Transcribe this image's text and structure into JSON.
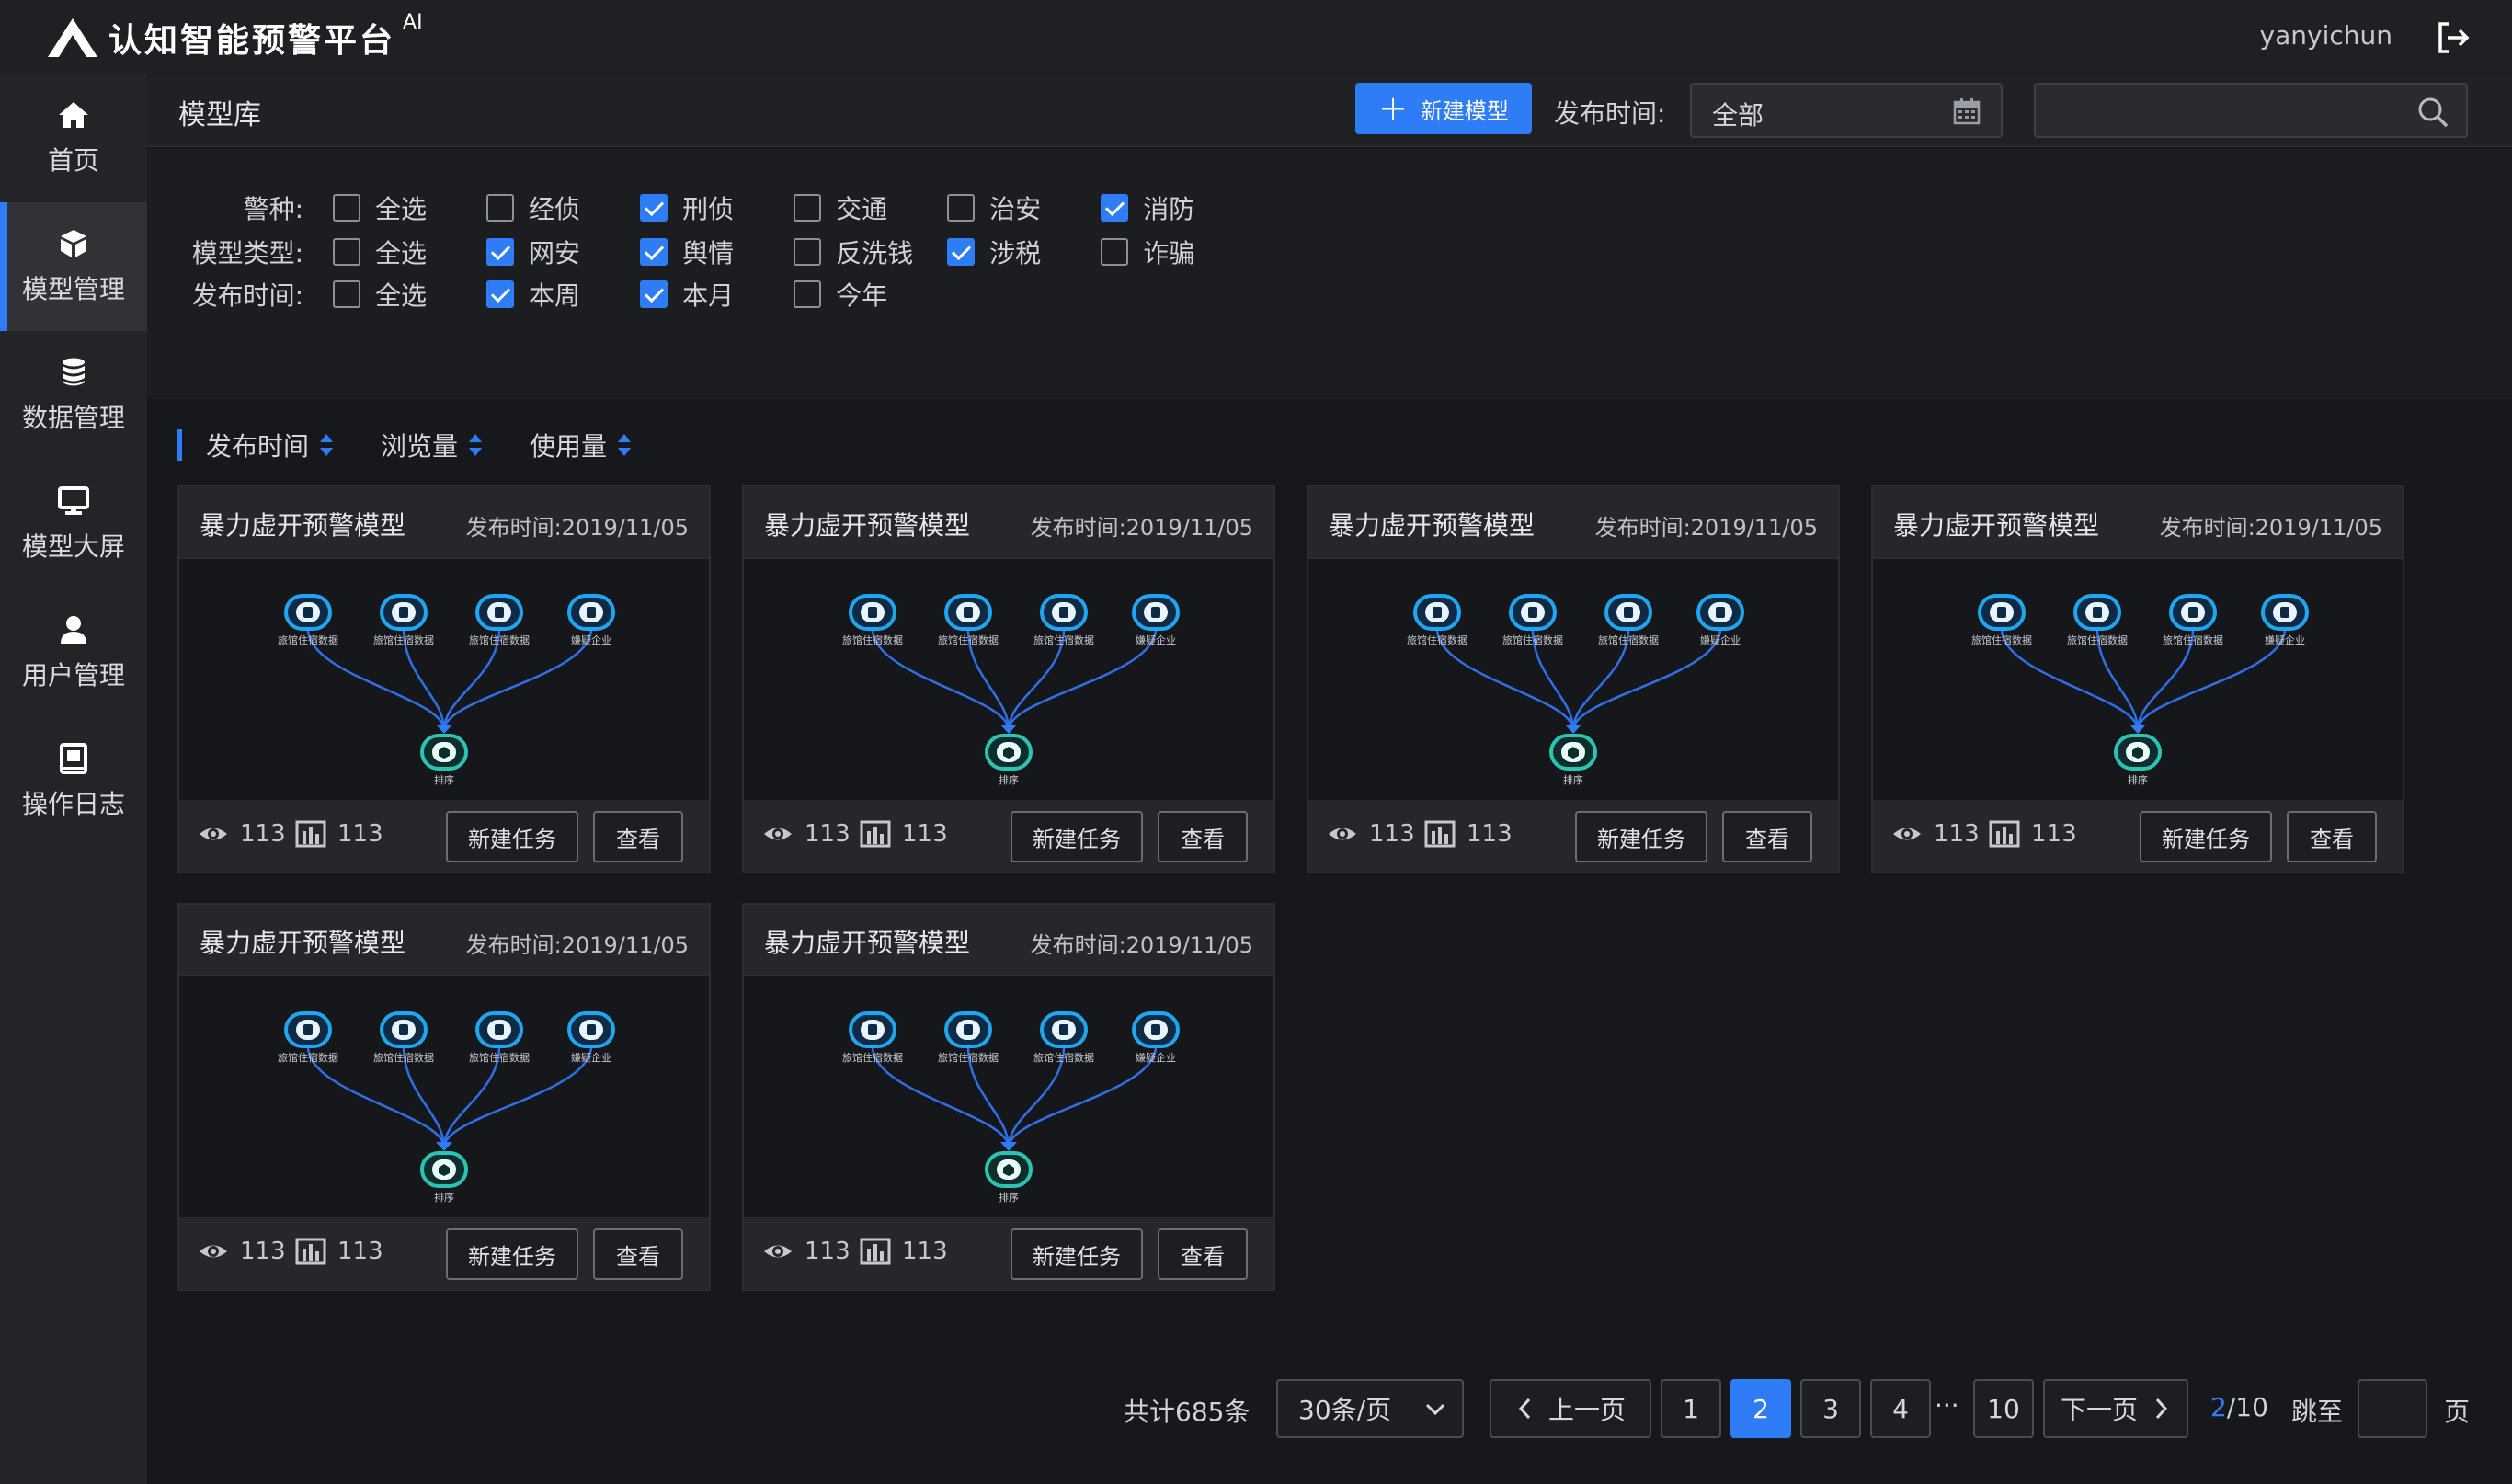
{
  "app": {
    "title": "认知智能预警平台",
    "ai_tag": "AI",
    "username": "yanyichun"
  },
  "sidebar": {
    "items": [
      {
        "label": "首页",
        "icon": "home-icon"
      },
      {
        "label": "模型管理",
        "icon": "cube-icon",
        "active": true
      },
      {
        "label": "数据管理",
        "icon": "database-icon"
      },
      {
        "label": "模型大屏",
        "icon": "monitor-icon"
      },
      {
        "label": "用户管理",
        "icon": "user-icon"
      },
      {
        "label": "操作日志",
        "icon": "log-book-icon"
      }
    ]
  },
  "header": {
    "title": "模型库",
    "new_model_label": "新建模型",
    "publish_label": "发布时间:",
    "publish_value": "全部"
  },
  "filters": [
    {
      "label": "警种:",
      "options": [
        {
          "label": "全选",
          "checked": false
        },
        {
          "label": "经侦",
          "checked": false
        },
        {
          "label": "刑侦",
          "checked": true
        },
        {
          "label": "交通",
          "checked": false
        },
        {
          "label": "治安",
          "checked": false
        },
        {
          "label": "消防",
          "checked": true
        }
      ]
    },
    {
      "label": "模型类型:",
      "options": [
        {
          "label": "全选",
          "checked": false
        },
        {
          "label": "网安",
          "checked": true
        },
        {
          "label": "舆情",
          "checked": true
        },
        {
          "label": "反洗钱",
          "checked": false
        },
        {
          "label": "涉税",
          "checked": true
        },
        {
          "label": "诈骗",
          "checked": false
        }
      ]
    },
    {
      "label": "发布时间:",
      "options": [
        {
          "label": "全选",
          "checked": false
        },
        {
          "label": "本周",
          "checked": true
        },
        {
          "label": "本月",
          "checked": true
        },
        {
          "label": "今年",
          "checked": false
        }
      ]
    }
  ],
  "sort": [
    "发布时间",
    "浏览量",
    "使用量"
  ],
  "card_template": {
    "title": "暴力虚开预警模型",
    "date_label": "发布时间:2019/11/05",
    "views": "113",
    "uses": "113",
    "new_task_label": "新建任务",
    "view_label": "查看",
    "diagram": {
      "sources": [
        "旅馆住宿数据",
        "旅馆住宿数据",
        "旅馆住宿数据",
        "嫌疑企业"
      ],
      "target": "排序"
    }
  },
  "card_count": 6,
  "pagination": {
    "total": "共计685条",
    "page_size": "30条/页",
    "prev": "上一页",
    "next": "下一页",
    "pages": [
      "1",
      "2",
      "3",
      "4"
    ],
    "ellipsis": "···",
    "last_page": "10",
    "current": "2",
    "current_of": "2",
    "of_total": "/10",
    "jump_label": "跳至",
    "page_suffix": "页"
  },
  "colors": {
    "accent": "#2f7df6",
    "node_blue": "#1ea7f0",
    "node_teal": "#2bc4b4"
  }
}
